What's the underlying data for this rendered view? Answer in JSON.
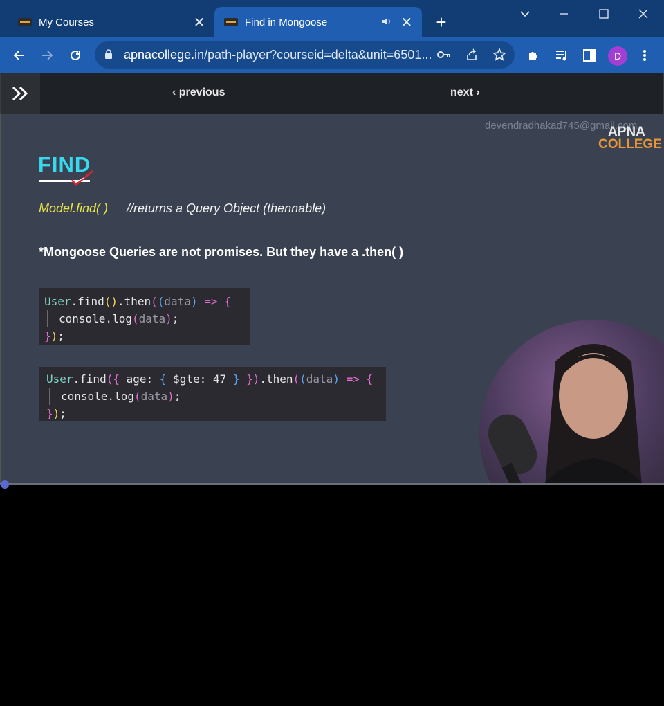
{
  "browser": {
    "tabs": [
      {
        "title": "My Courses",
        "active": false
      },
      {
        "title": "Find in Mongoose",
        "active": true
      }
    ],
    "url_host": "apnacollege.in",
    "url_path": "/path-player?courseid=delta&unit=6501..."
  },
  "profile": {
    "initial": "D"
  },
  "player": {
    "previous_label": "previous",
    "next_label": "next"
  },
  "slide": {
    "watermark": "devendradhakad745@gmail.com",
    "logo_line1": "APNA",
    "logo_line2": "COLLEGE",
    "title": "FIND",
    "model_call": "Model.find( )",
    "model_comment": "//returns a Query Object (thennable)",
    "note": "*Mongoose Queries are not promises. But they have a .then( )"
  },
  "colors": {
    "tabstrip": "#123d74",
    "toolbar": "#1f5eb0",
    "slide_bg": "#3a4150",
    "find_title": "#38d9ee",
    "accent_red": "#e2242d"
  }
}
